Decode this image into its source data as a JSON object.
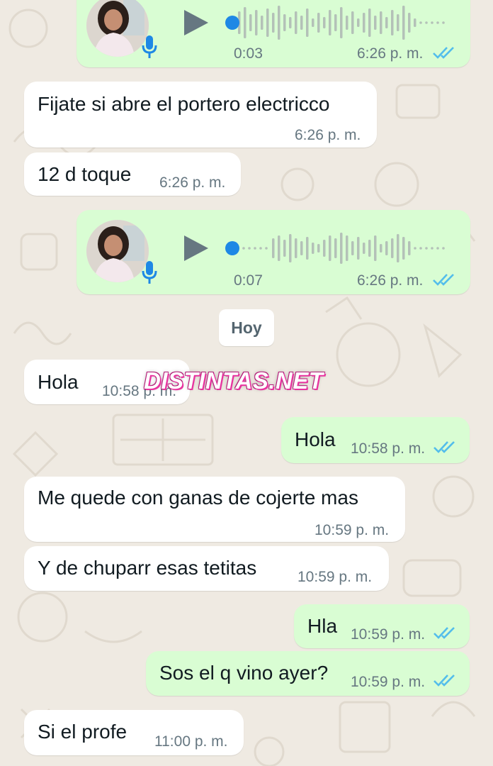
{
  "colors": {
    "background": "#efeae2",
    "incoming_bubble": "#ffffff",
    "outgoing_bubble": "#d9fdd3",
    "read_ticks": "#53bdeb",
    "voice_accent": "#1e88e5",
    "watermark_outline": "#e8339f"
  },
  "voice_messages": [
    {
      "duration": "0:03",
      "time": "6:26 p. m.",
      "status": "read",
      "progress": 0
    },
    {
      "duration": "0:07",
      "time": "6:26 p. m.",
      "status": "read",
      "progress": 0
    }
  ],
  "messages": [
    {
      "direction": "incoming",
      "text": "Fijate si abre el portero electricco",
      "time": "6:26 p. m."
    },
    {
      "direction": "incoming",
      "text": "12 d toque",
      "time": "6:26 p. m."
    },
    {
      "direction": "incoming",
      "text": "Hola",
      "time": "10:58 p. m."
    },
    {
      "direction": "outgoing",
      "text": "Hola",
      "time": "10:58 p. m.",
      "status": "read"
    },
    {
      "direction": "incoming",
      "text": "Me quede con ganas de cojerte mas",
      "time": "10:59 p. m."
    },
    {
      "direction": "incoming",
      "text": "Y de chuparr esas tetitas",
      "time": "10:59 p. m."
    },
    {
      "direction": "outgoing",
      "text": "Hla",
      "time": "10:59 p. m.",
      "status": "read"
    },
    {
      "direction": "outgoing",
      "text": "Sos el q vino ayer?",
      "time": "10:59 p. m.",
      "status": "read"
    },
    {
      "direction": "incoming",
      "text": "Si el profe",
      "time": "11:00 p. m."
    }
  ],
  "date_separator": "Hoy",
  "watermark": "DISTINTAS.NET"
}
